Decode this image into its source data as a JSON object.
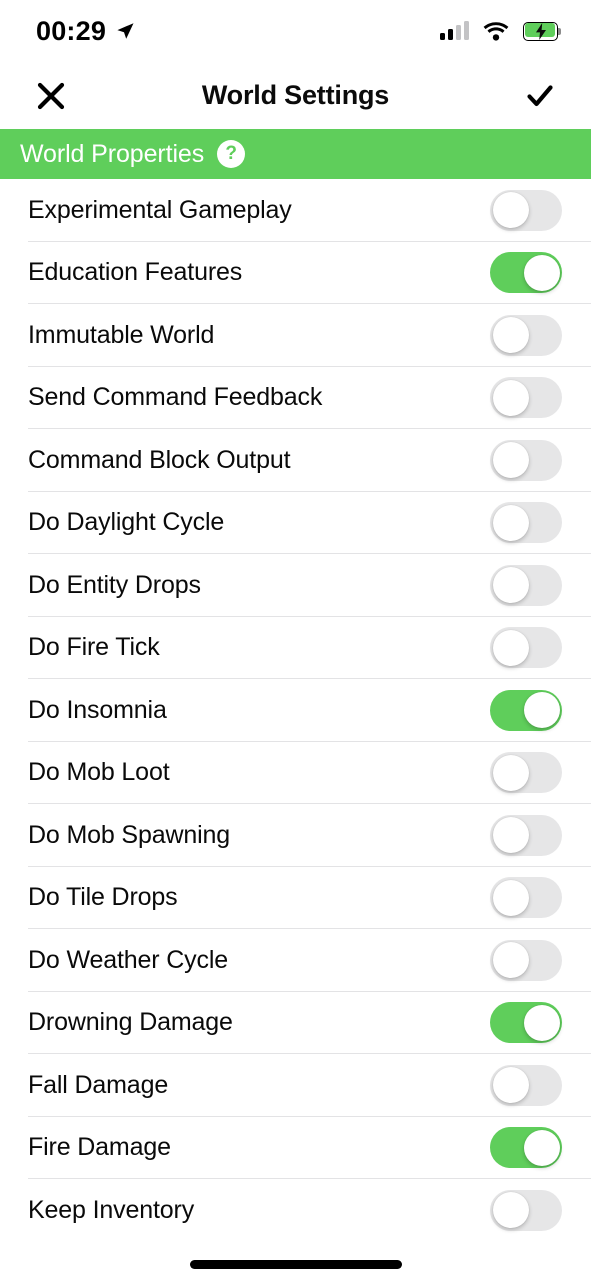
{
  "status_bar": {
    "time": "00:29",
    "location_icon": "location-arrow-icon",
    "signal_icon": "cellular-signal-icon",
    "signal_bars_filled": 2,
    "signal_bars_total": 4,
    "wifi_icon": "wifi-icon",
    "battery_icon": "battery-charging-icon",
    "battery_charging": true,
    "battery_color": "#5fce5b"
  },
  "navbar": {
    "close_icon": "close-icon",
    "close_label": "✕",
    "title": "World Settings",
    "confirm_icon": "checkmark-icon",
    "confirm_label": "✓"
  },
  "section": {
    "title": "World Properties",
    "help_label": "?",
    "accent_color": "#5fce5b"
  },
  "settings": [
    {
      "label": "Experimental Gameplay",
      "enabled": false
    },
    {
      "label": "Education Features",
      "enabled": true
    },
    {
      "label": "Immutable World",
      "enabled": false
    },
    {
      "label": "Send Command Feedback",
      "enabled": false
    },
    {
      "label": "Command Block Output",
      "enabled": false
    },
    {
      "label": "Do Daylight Cycle",
      "enabled": false
    },
    {
      "label": "Do Entity Drops",
      "enabled": false
    },
    {
      "label": "Do Fire Tick",
      "enabled": false
    },
    {
      "label": "Do Insomnia",
      "enabled": true
    },
    {
      "label": "Do Mob Loot",
      "enabled": false
    },
    {
      "label": "Do Mob Spawning",
      "enabled": false
    },
    {
      "label": "Do Tile Drops",
      "enabled": false
    },
    {
      "label": "Do Weather Cycle",
      "enabled": false
    },
    {
      "label": "Drowning Damage",
      "enabled": true
    },
    {
      "label": "Fall Damage",
      "enabled": false
    },
    {
      "label": "Fire Damage",
      "enabled": true
    },
    {
      "label": "Keep Inventory",
      "enabled": false
    }
  ],
  "home_indicator": "home-indicator"
}
